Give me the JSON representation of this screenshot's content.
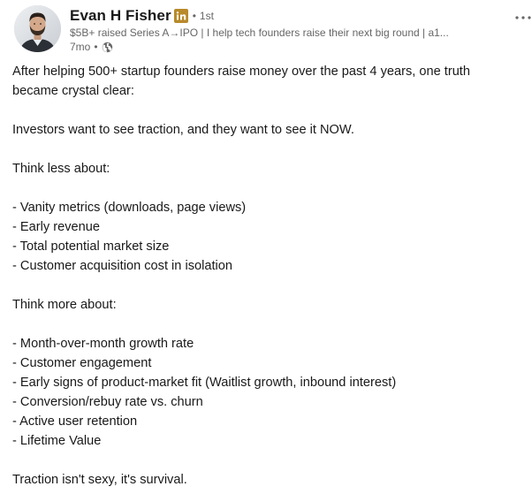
{
  "author": {
    "name": "Evan H Fisher",
    "badge_icon": "linkedin-icon",
    "degree": "1st",
    "headline": "$5B+ raised Series A→IPO | I help tech founders raise their next big round | a1...",
    "time": "7mo",
    "visibility_icon": "globe-icon"
  },
  "actions": {
    "more_icon": "more-horizontal-icon",
    "more_label": "···"
  },
  "post": {
    "lines": [
      "After helping 500+ startup founders raise money over the past 4 years, one truth became crystal clear:",
      "",
      "Investors want to see traction, and they want to see it NOW.",
      "",
      "Think less about:",
      "",
      "- Vanity metrics (downloads, page views)",
      "- Early revenue",
      "- Total potential market size",
      "- Customer acquisition cost in isolation",
      "",
      "Think more about:",
      "",
      "- Month-over-month growth rate",
      "- Customer engagement",
      "- Early signs of product-market fit (Waitlist growth, inbound interest)",
      "- Conversion/rebuy rate vs. churn",
      "- Active user retention",
      "- Lifetime Value",
      "",
      "Traction isn't sexy, it's survival."
    ]
  },
  "colors": {
    "text_primary": "#191919",
    "text_secondary": "#666666",
    "linkedin_blue": "#0a66c2",
    "badge_gold": "#b88a2b"
  }
}
